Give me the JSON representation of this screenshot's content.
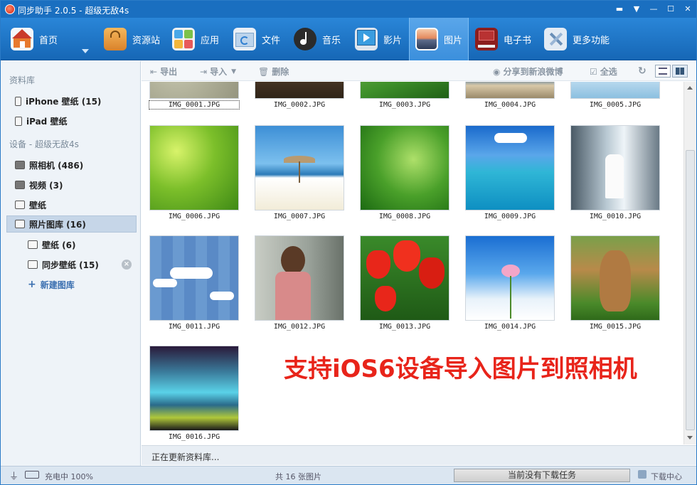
{
  "titlebar": {
    "title": "同步助手 2.0.5 - 超级无敌4s",
    "controls": [
      "▬",
      "▼",
      "—",
      "☐",
      "✕"
    ]
  },
  "toolbar": {
    "items": [
      {
        "label": "首页",
        "icon": "home-icon"
      },
      {
        "label": "资源站",
        "icon": "shopping-bag-icon"
      },
      {
        "label": "应用",
        "icon": "apps-icon"
      },
      {
        "label": "文件",
        "icon": "folder-sync-icon"
      },
      {
        "label": "音乐",
        "icon": "music-icon"
      },
      {
        "label": "影片",
        "icon": "video-icon"
      },
      {
        "label": "图片",
        "icon": "picture-icon",
        "active": true
      },
      {
        "label": "电子书",
        "icon": "ebook-icon"
      },
      {
        "label": "更多功能",
        "icon": "tools-icon"
      }
    ]
  },
  "sidebar": {
    "library_header": "资料库",
    "iphone_wallpaper": "iPhone 壁纸 (15)",
    "ipad_wallpaper": "iPad 壁纸",
    "device_header": "设备 - 超级无敌4s",
    "camera": "照相机 (486)",
    "video": "视频 (3)",
    "wallpaper": "壁纸",
    "photo_library": "照片图库 (16)",
    "sub_wallpaper": "壁纸 (6)",
    "sync_wallpaper": "同步壁纸 (15)",
    "new_album": "新建图库"
  },
  "actionbar": {
    "export": "导出",
    "import": "导入",
    "delete": "删除",
    "share": "分享到新浪微博",
    "select_all": "全选"
  },
  "photos": [
    {
      "name": "IMG_0001.JPG"
    },
    {
      "name": "IMG_0002.JPG"
    },
    {
      "name": "IMG_0003.JPG"
    },
    {
      "name": "IMG_0004.JPG"
    },
    {
      "name": "IMG_0005.JPG"
    },
    {
      "name": "IMG_0006.JPG"
    },
    {
      "name": "IMG_0007.JPG"
    },
    {
      "name": "IMG_0008.JPG"
    },
    {
      "name": "IMG_0009.JPG"
    },
    {
      "name": "IMG_0010.JPG"
    },
    {
      "name": "IMG_0011.JPG"
    },
    {
      "name": "IMG_0012.JPG"
    },
    {
      "name": "IMG_0013.JPG"
    },
    {
      "name": "IMG_0014.JPG"
    },
    {
      "name": "IMG_0015.JPG"
    },
    {
      "name": "IMG_0016.JPG"
    }
  ],
  "promo_text": "支持iOS6设备导入图片到照相机",
  "status": {
    "updating": "正在更新资料库..."
  },
  "footer": {
    "battery": "充电中 100%",
    "count": "共 16 张图片",
    "tasks": "当前没有下载任务",
    "download_center": "下载中心"
  },
  "colors": {
    "accent": "#1a6fc0",
    "promo": "#e8241a"
  }
}
